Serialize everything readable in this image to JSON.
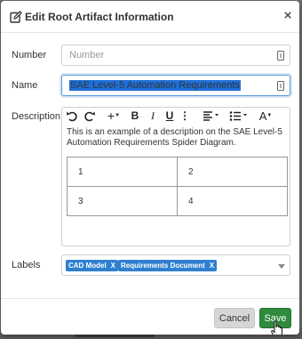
{
  "dialog": {
    "title": "Edit Root Artifact Information",
    "close_label": "×"
  },
  "form": {
    "number": {
      "label": "Number",
      "value": "",
      "placeholder": "Number"
    },
    "name": {
      "label": "Name",
      "value": "SAE Level-5 Automation Requirements"
    },
    "description": {
      "label": "Description",
      "text": "This is an example of a description on the SAE Level-5 Automation Requirements Spider Diagram.",
      "table": [
        [
          "1",
          "2"
        ],
        [
          "3",
          "4"
        ]
      ]
    },
    "labels": {
      "label": "Labels",
      "tags": [
        {
          "text": "CAD Model",
          "remove": "X"
        },
        {
          "text": "Requirements Document",
          "remove": "X"
        }
      ]
    }
  },
  "toolbar": {
    "undo_icon": "undo-icon",
    "redo_icon": "redo-icon",
    "insert_label": "+",
    "bold_label": "B",
    "italic_label": "I",
    "underline_label": "U",
    "more_label": "⋮",
    "font_label": "A"
  },
  "buttons": {
    "cancel": "Cancel",
    "save": "Save"
  },
  "colors": {
    "save": "#2f8a3e",
    "tag": "#2f7fd0",
    "selection": "#1e6fd9"
  }
}
